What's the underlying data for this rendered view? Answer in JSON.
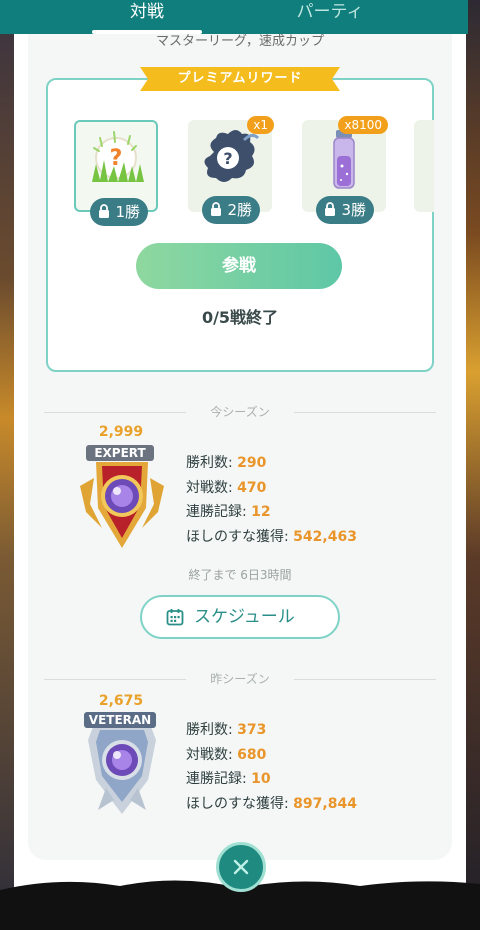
{
  "tabs": {
    "battle": "対戦",
    "party": "パーティ"
  },
  "league": {
    "subtitle": "マスターリーグ，速成カップ"
  },
  "rewards": {
    "ribbon": "プレミアムリワード",
    "items": [
      {
        "icon": "mystery-grass-encounter-icon",
        "wins": "1勝",
        "count": ""
      },
      {
        "icon": "mystery-stardust-icon",
        "wins": "2勝",
        "count": "x1"
      },
      {
        "icon": "stardust-vial-icon",
        "wins": "3勝",
        "count": "x8100"
      }
    ],
    "join_button": "参戦",
    "progress": "0/5戦終了"
  },
  "current_season": {
    "header": "今シーズン",
    "rating": "2,999",
    "rank": "EXPERT",
    "stats": [
      {
        "label": "勝利数: ",
        "value": "290"
      },
      {
        "label": "対戦数: ",
        "value": "470"
      },
      {
        "label": "連勝記録: ",
        "value": "12"
      },
      {
        "label": "ほしのすな獲得: ",
        "value": "542,463"
      }
    ],
    "ends_in": "終了まで 6日3時間",
    "schedule_button": "スケジュール"
  },
  "last_season": {
    "header": "昨シーズン",
    "rating": "2,675",
    "rank": "VETERAN",
    "stats": [
      {
        "label": "勝利数: ",
        "value": "373"
      },
      {
        "label": "対戦数: ",
        "value": "680"
      },
      {
        "label": "連勝記録: ",
        "value": "10"
      },
      {
        "label": "ほしのすな獲得: ",
        "value": "897,844"
      }
    ]
  },
  "colors": {
    "teal": "#0f7e7c",
    "accent": "#7fd2c6",
    "gold": "#f4bd1d",
    "value_orange": "#e9952a"
  }
}
